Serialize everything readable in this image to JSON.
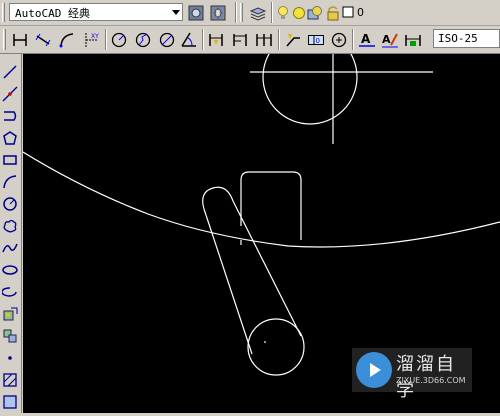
{
  "toolbar": {
    "workspace_value": "AutoCAD 经典",
    "layer_current": "0",
    "dimstyle_value": "ISO-25"
  },
  "watermark": {
    "title": "溜溜自学",
    "url": "ZIXUE.3D66.COM"
  },
  "colors": {
    "canvas_bg": "#000000",
    "geometry": "#ffffff",
    "toolbar_bg": "#d4d0c8",
    "watermark_accent": "#3a8fd8"
  }
}
